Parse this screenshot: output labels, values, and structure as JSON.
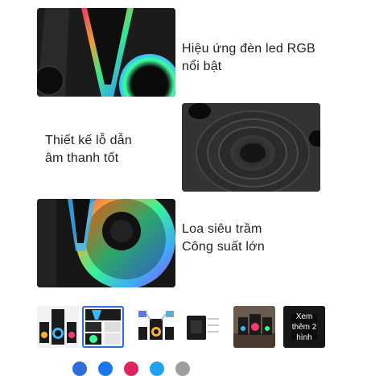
{
  "features": [
    {
      "text_line1": "Hiệu ứng đèn led RGB",
      "text_line2": "nổi bật"
    },
    {
      "text_line1": "Thiết kế lỗ dẫn",
      "text_line2": "âm thanh tốt"
    },
    {
      "text_line1": "Loa siêu trầm",
      "text_line2": "Công suất lớn"
    }
  ],
  "gallery": {
    "active_index": 1,
    "more_label": [
      "Xem",
      "thêm 2",
      "hình"
    ]
  },
  "colors": {
    "accent": "#2d6cdf",
    "rgb_gradient": [
      "#ff3b6b",
      "#ffb13b",
      "#3bff9a",
      "#3bb8ff",
      "#b83bff"
    ]
  },
  "share": {
    "colors": [
      "#2d6cdf",
      "#1877f2",
      "#e0245e",
      "#1da1f2",
      "#9e9e9e"
    ]
  }
}
